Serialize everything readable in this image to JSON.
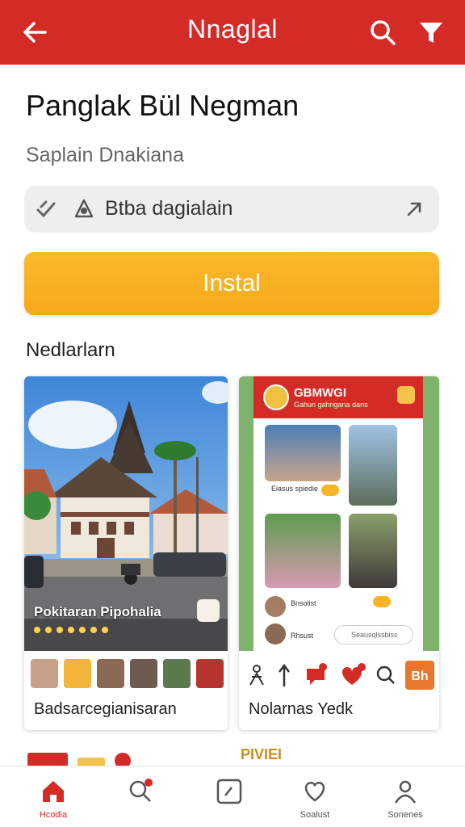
{
  "topbar": {
    "title": "Nnaglal"
  },
  "app": {
    "name": "Panglak Bül Negman",
    "subtitle": "Saplain Dnakiana",
    "info_label": "Btba dagialain",
    "install_label": "Instal"
  },
  "section": {
    "title": "Nedlarlarn"
  },
  "cards": [
    {
      "overlay_caption": "Pokitaran Pipohalia",
      "label": "Badsarcegianisaran"
    },
    {
      "phone_title": "GBMWGI",
      "phone_subtitle": "Gahun gahngana dans",
      "caption_a": "Eiasus spiedie",
      "caption_b": "Bnsolist",
      "caption_c": "Rhsust",
      "reply_placeholder": "Seausqlssbiss",
      "label": "Nolarnas Yedk"
    }
  ],
  "promo_text": "PIVIEI",
  "bottom_nav": [
    {
      "label": "Hcodia",
      "icon": "home-icon",
      "active": true
    },
    {
      "label": "",
      "icon": "search-notification-icon",
      "active": false
    },
    {
      "label": "",
      "icon": "app-tile-icon",
      "active": false
    },
    {
      "label": "Soalust",
      "icon": "chat-heart-icon",
      "active": false
    },
    {
      "label": "Sonenes",
      "icon": "profile-icon",
      "active": false
    }
  ],
  "colors": {
    "brand_red": "#d42b27",
    "install_yellow": "#f6a91c"
  }
}
